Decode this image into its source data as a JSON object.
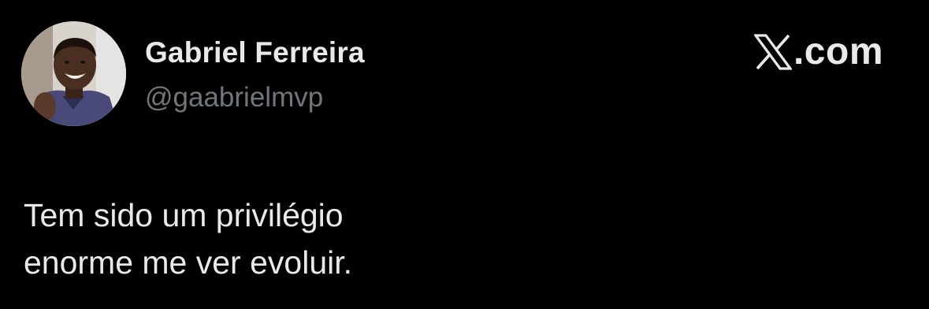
{
  "author": {
    "display_name": "Gabriel Ferreira",
    "handle": "@gaabrielmvp",
    "avatar_icon": "profile-photo"
  },
  "brand": {
    "icon": "x-logo-icon",
    "text": ".com"
  },
  "tweet": {
    "lines": [
      "Tem sido um privilégio",
      "enorme me ver evoluir."
    ]
  },
  "colors": {
    "background": "#000000",
    "primary_text": "#e7e9ea",
    "secondary_text": "#71767b"
  }
}
